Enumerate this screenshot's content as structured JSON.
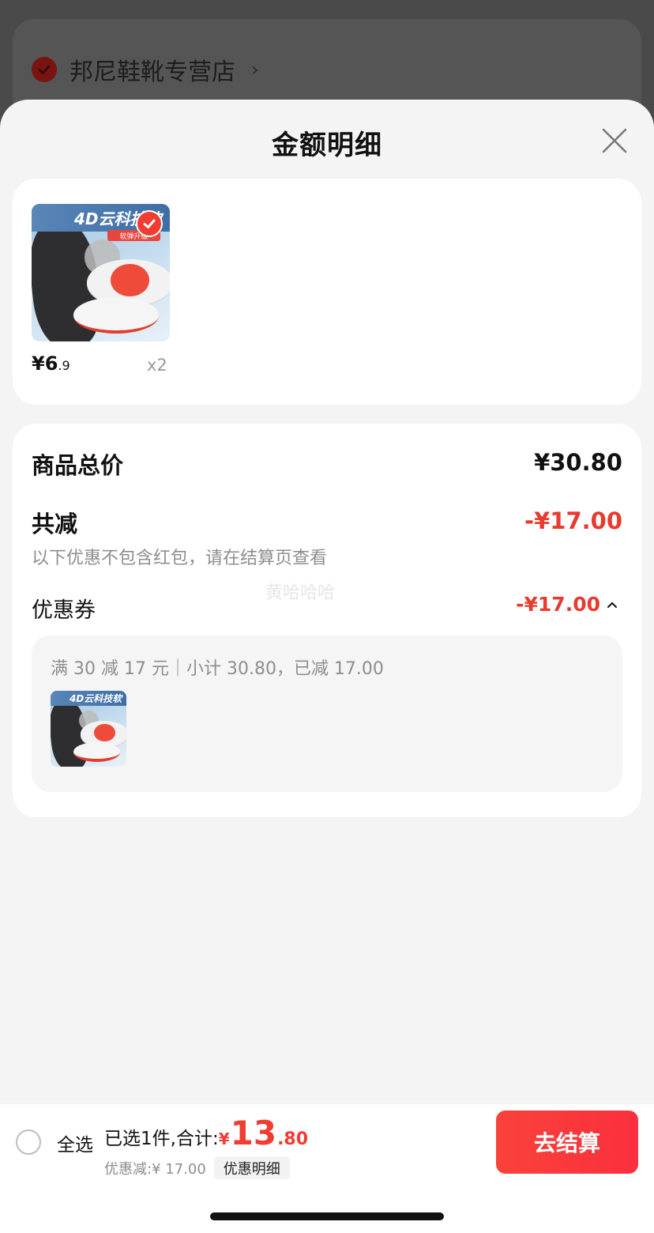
{
  "store": {
    "name": "邦尼鞋靴专营店",
    "arrow": "›"
  },
  "sheet": {
    "title": "金额明细",
    "close_icon": "close-icon"
  },
  "product": {
    "image_banner": "4D云科技软",
    "image_tag": "软弹升级",
    "selected": true,
    "price_int": "¥6",
    "price_dec": ".9",
    "quantity": "x2"
  },
  "totals": {
    "goods_total_label": "商品总价",
    "goods_total_value": "¥30.80",
    "reduce_label": "共减",
    "reduce_value": "-¥17.00",
    "note": "以下优惠不包含红包，请在结算页查看",
    "coupon_label": "优惠券",
    "coupon_value": "-¥17.00",
    "coupon_detail": "满 30 减 17 元｜小计 30.80，已减 17.00",
    "watermark": "黄哈哈哈"
  },
  "bottom_bar": {
    "select_all": "全选",
    "selected_summary": "已选1件,合计:",
    "total_yen": "¥",
    "total_int": "13",
    "total_dec": ".80",
    "discount": "优惠减:¥ 17.00",
    "detail_link": "优惠明细",
    "checkout": "去结算"
  },
  "colors": {
    "accent_red": "#f03c33",
    "overlay": "#4a4a4a",
    "sheet_bg": "#f4f4f4"
  }
}
